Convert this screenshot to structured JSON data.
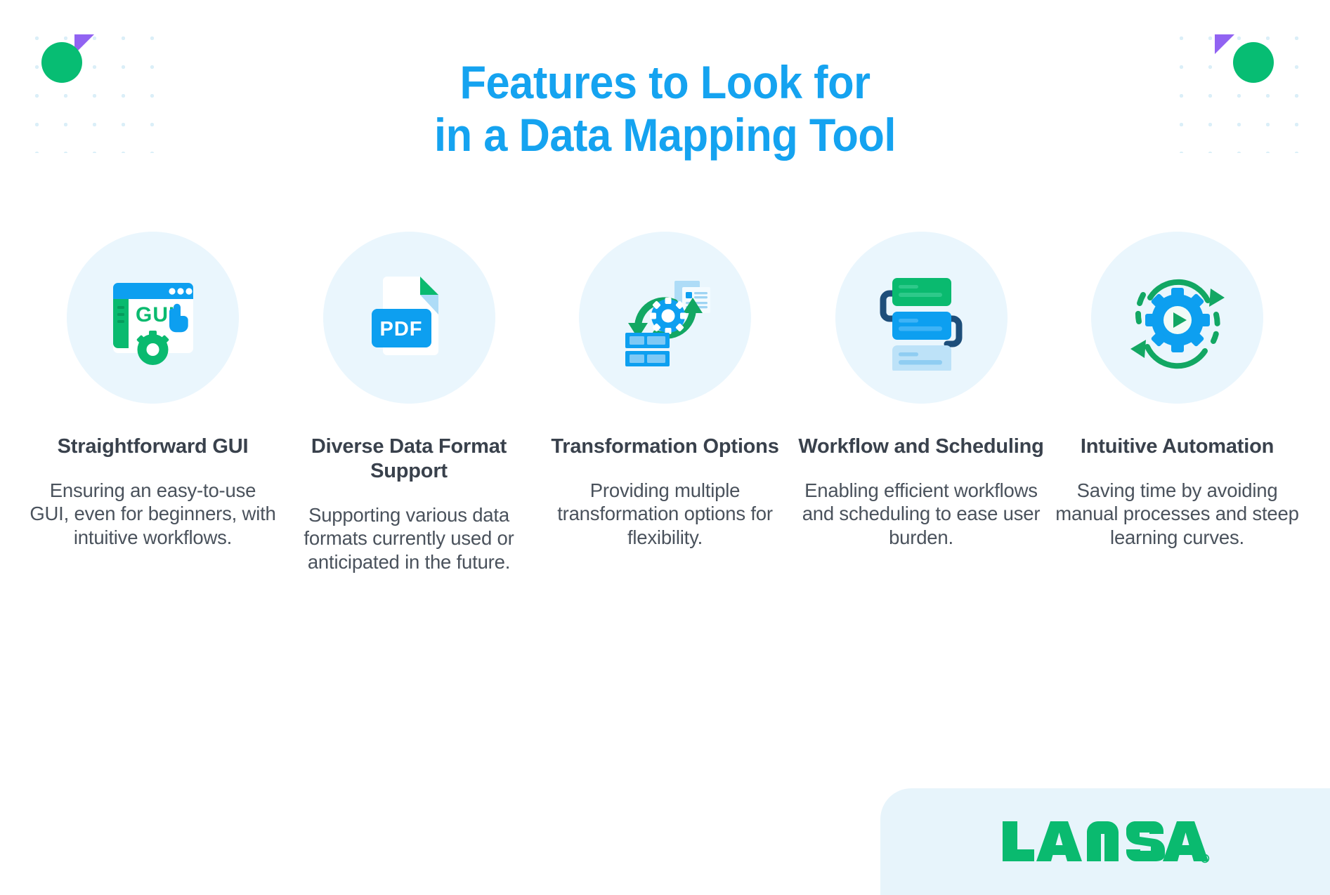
{
  "title": {
    "line1": "Features to Look for",
    "line2": "in a Data Mapping Tool",
    "color": "#15a3f0"
  },
  "decorations": {
    "circle_color": "#07bd73",
    "triangle_color": "#9163f2",
    "dot_color": "#d9eef8"
  },
  "palette": {
    "blue": "#0d9ff0",
    "green": "#0aba6f",
    "light_blue": "#aedcf7",
    "navy": "#1d4e7a",
    "icon_bg": "#eaf6fd",
    "heading": "#39414c",
    "body": "#4a525c"
  },
  "features": [
    {
      "icon": "gui-window-icon",
      "icon_label": "GUI",
      "title": "Straightforward GUI",
      "desc": "Ensuring an easy-to-use GUI, even for beginners, with intuitive workflows."
    },
    {
      "icon": "pdf-file-icon",
      "icon_label": "PDF",
      "title": "Diverse Data Format Support",
      "desc": "Supporting various data formats currently used or anticipated in the future."
    },
    {
      "icon": "data-transformation-icon",
      "icon_label": "",
      "title": "Transformation Options",
      "desc": "Providing multiple transformation options for flexibility."
    },
    {
      "icon": "workflow-stack-icon",
      "icon_label": "",
      "title": "Workflow and Scheduling",
      "desc": "Enabling efficient workflows and scheduling to ease user burden."
    },
    {
      "icon": "automation-gear-play-icon",
      "icon_label": "",
      "title": "Intuitive Automation",
      "desc": "Saving time by avoiding manual processes and steep learning curves."
    }
  ],
  "logo": {
    "name": "LANSA",
    "registered_mark": "®",
    "color": "#0aba6f"
  }
}
